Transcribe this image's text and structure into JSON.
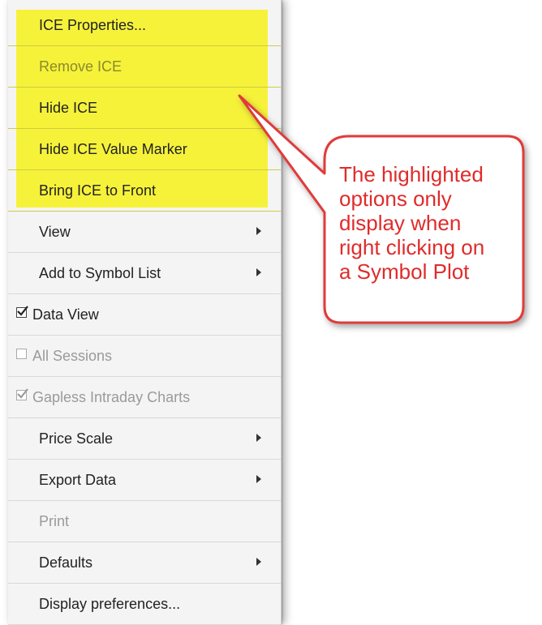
{
  "menu": {
    "items": [
      {
        "label": "ICE Properties...",
        "highlighted": true,
        "enabled": true
      },
      {
        "label": "Remove ICE",
        "highlighted": true,
        "enabled": false
      },
      {
        "label": "Hide ICE",
        "highlighted": true,
        "enabled": true
      },
      {
        "label": "Hide ICE Value Marker",
        "highlighted": true,
        "enabled": true
      },
      {
        "label": "Bring ICE to Front",
        "highlighted": true,
        "enabled": true
      },
      {
        "label": "View",
        "submenu": true,
        "enabled": true
      },
      {
        "label": "Add to Symbol List",
        "submenu": true,
        "enabled": true
      },
      {
        "label": "Data View",
        "checkbox": true,
        "checked": true,
        "enabled": true
      },
      {
        "label": "All Sessions",
        "checkbox": true,
        "checked": false,
        "enabled": false
      },
      {
        "label": "Gapless Intraday Charts",
        "checkbox": true,
        "checked": true,
        "enabled": false
      },
      {
        "label": "Price Scale",
        "submenu": true,
        "enabled": true
      },
      {
        "label": "Export Data",
        "submenu": true,
        "enabled": true
      },
      {
        "label": "Print",
        "enabled": false
      },
      {
        "label": "Defaults",
        "submenu": true,
        "enabled": true
      },
      {
        "label": "Display preferences...",
        "enabled": true
      }
    ]
  },
  "callout": {
    "text": "The highlighted options only display when right clicking on a Symbol Plot",
    "lines": [
      "The highlighted",
      "options only",
      "display when",
      "right clicking on",
      "a Symbol Plot"
    ]
  },
  "colors": {
    "highlight": "#f6f23a",
    "callout_border": "#e03a3a",
    "callout_text": "#e02b2b"
  }
}
